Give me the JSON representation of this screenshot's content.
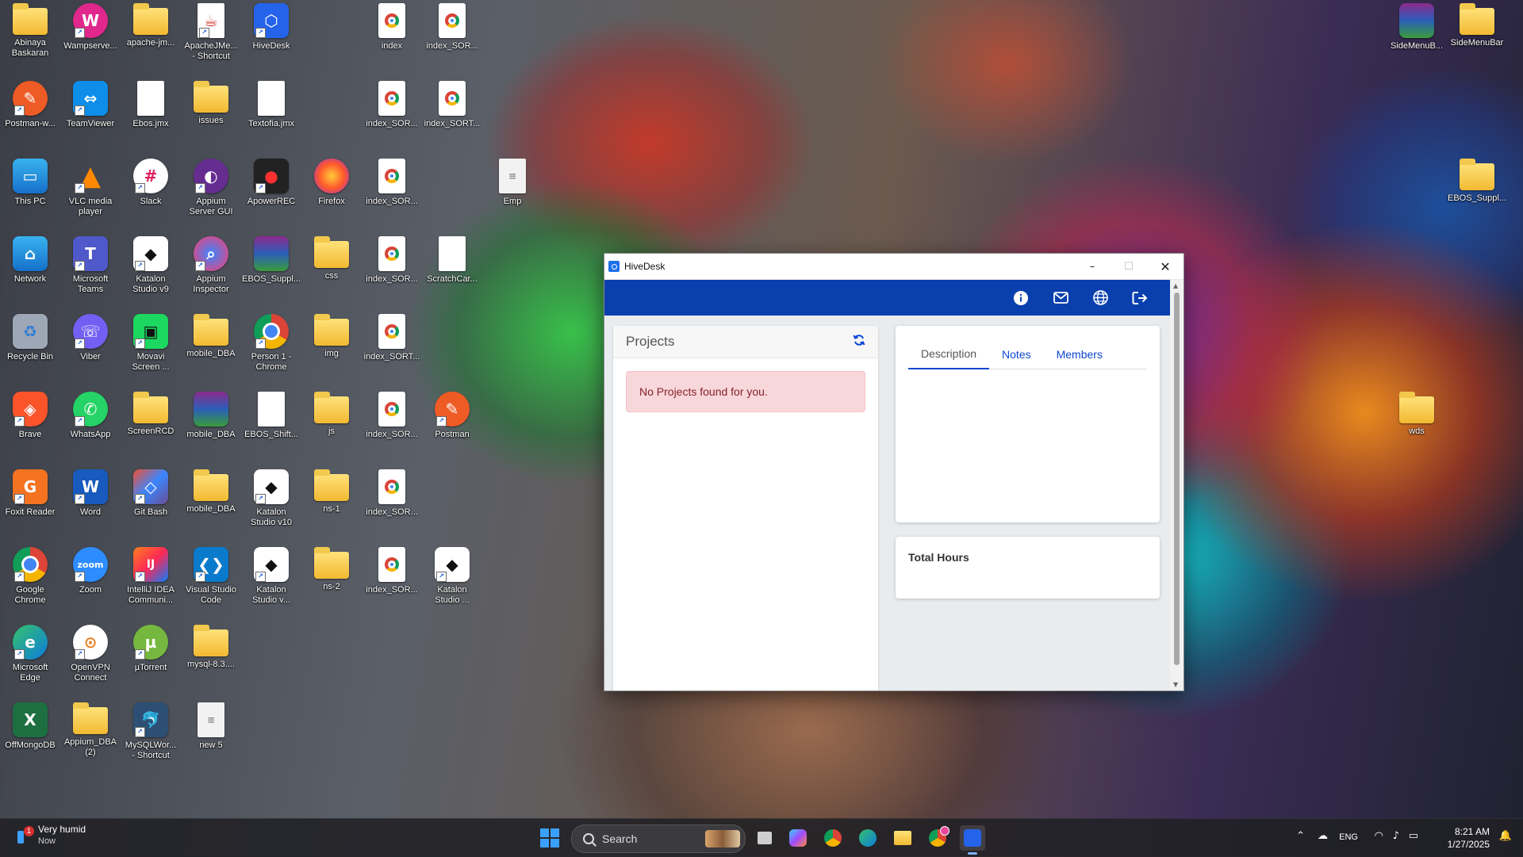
{
  "desktop": {
    "icons": [
      {
        "label": "Abinaya\nBaskaran",
        "icon": "folder-icon"
      },
      {
        "label": "Wampserve...",
        "icon": "wamp-icon"
      },
      {
        "label": "apache-jm...",
        "icon": "folder-icon"
      },
      {
        "label": "ApacheJMe...\n- Shortcut",
        "icon": "java-icon"
      },
      {
        "label": "HiveDesk",
        "icon": "hivedesk-icon"
      },
      {
        "label": "index",
        "icon": "chrome-html-icon"
      },
      {
        "label": "index_SOR...",
        "icon": "chrome-html-icon"
      },
      {
        "label": "SideMenuB...",
        "icon": "winrar-icon"
      },
      {
        "label": "SideMenuBar",
        "icon": "folder-icon"
      },
      {
        "label": "Postman-w...",
        "icon": "postman-icon"
      },
      {
        "label": "TeamViewer",
        "icon": "teamviewer-icon"
      },
      {
        "label": "Ebos.jmx",
        "icon": "file-icon"
      },
      {
        "label": "issues",
        "icon": "folder-icon"
      },
      {
        "label": "Textofia.jmx",
        "icon": "file-icon"
      },
      {
        "label": "index_SOR...",
        "icon": "chrome-html-icon"
      },
      {
        "label": "index_SORT...",
        "icon": "chrome-html-icon"
      },
      {
        "label": "This PC",
        "icon": "monitor-icon"
      },
      {
        "label": "VLC media\nplayer",
        "icon": "vlc-icon"
      },
      {
        "label": "Slack",
        "icon": "slack-icon"
      },
      {
        "label": "Appium\nServer GUI",
        "icon": "appium-icon"
      },
      {
        "label": "ApowerREC",
        "icon": "apowerrec-icon"
      },
      {
        "label": "Firefox",
        "icon": "firefox-icon"
      },
      {
        "label": "index_SOR...",
        "icon": "chrome-html-icon"
      },
      {
        "label": "Emp",
        "icon": "text-file-icon"
      },
      {
        "label": "EBOS_Suppl...",
        "icon": "folder-icon"
      },
      {
        "label": "Network",
        "icon": "network-icon"
      },
      {
        "label": "Microsoft\nTeams",
        "icon": "teams-icon"
      },
      {
        "label": "Katalon\nStudio v9",
        "icon": "katalon-icon"
      },
      {
        "label": "Appium\nInspector",
        "icon": "appium-inspector-icon"
      },
      {
        "label": "EBOS_Suppl...",
        "icon": "winrar-icon"
      },
      {
        "label": "css",
        "icon": "folder-icon"
      },
      {
        "label": "index_SOR...",
        "icon": "chrome-html-icon"
      },
      {
        "label": "ScratchCar...",
        "icon": "file-icon"
      },
      {
        "label": "Recycle Bin",
        "icon": "recycle-bin-icon"
      },
      {
        "label": "Viber",
        "icon": "viber-icon"
      },
      {
        "label": "Movavi\nScreen ...",
        "icon": "movavi-icon"
      },
      {
        "label": "mobile_DBA",
        "icon": "folder-icon"
      },
      {
        "label": "Person 1 -\nChrome",
        "icon": "chrome-icon"
      },
      {
        "label": "img",
        "icon": "folder-icon"
      },
      {
        "label": "index_SORT...",
        "icon": "chrome-html-icon"
      },
      {
        "label": "Brave",
        "icon": "brave-icon"
      },
      {
        "label": "WhatsApp",
        "icon": "whatsapp-icon"
      },
      {
        "label": "ScreenRCD",
        "icon": "folder-icon"
      },
      {
        "label": "mobile_DBA",
        "icon": "winrar-icon"
      },
      {
        "label": "EBOS_Shift...",
        "icon": "file-icon"
      },
      {
        "label": "js",
        "icon": "folder-icon"
      },
      {
        "label": "index_SOR...",
        "icon": "chrome-html-icon"
      },
      {
        "label": "Postman",
        "icon": "postman-icon"
      },
      {
        "label": "wds",
        "icon": "folder-icon"
      },
      {
        "label": "Foxit Reader",
        "icon": "foxit-icon"
      },
      {
        "label": "Word",
        "icon": "word-icon"
      },
      {
        "label": "Git Bash",
        "icon": "git-icon"
      },
      {
        "label": "mobile_DBA",
        "icon": "zip-folder-icon"
      },
      {
        "label": "Katalon\nStudio v10",
        "icon": "katalon-icon"
      },
      {
        "label": "ns-1",
        "icon": "folder-icon"
      },
      {
        "label": "index_SOR...",
        "icon": "chrome-html-icon"
      },
      {
        "label": "Google\nChrome",
        "icon": "chrome-icon"
      },
      {
        "label": "Zoom",
        "icon": "zoom-icon"
      },
      {
        "label": "IntelliJ IDEA\nCommuni...",
        "icon": "intellij-icon"
      },
      {
        "label": "Visual Studio\nCode",
        "icon": "vscode-icon"
      },
      {
        "label": "Katalon\nStudio v...",
        "icon": "katalon-icon"
      },
      {
        "label": "ns-2",
        "icon": "folder-icon"
      },
      {
        "label": "index_SOR...",
        "icon": "chrome-html-icon"
      },
      {
        "label": "Katalon\nStudio ...",
        "icon": "katalon-icon"
      },
      {
        "label": "Microsoft\nEdge",
        "icon": "edge-icon"
      },
      {
        "label": "OpenVPN\nConnect",
        "icon": "openvpn-icon"
      },
      {
        "label": "µTorrent",
        "icon": "utorrent-icon"
      },
      {
        "label": "mysql-8.3....",
        "icon": "zip-folder-icon"
      },
      {
        "label": "OffMongoDB",
        "icon": "excel-icon"
      },
      {
        "label": "Appium_DBA\n(2)",
        "icon": "zip-folder-icon"
      },
      {
        "label": "MySQLWor...\n- Shortcut",
        "icon": "mysql-workbench-icon"
      },
      {
        "label": "new 5",
        "icon": "text-file-icon"
      }
    ]
  },
  "window": {
    "title": "HiveDesk",
    "controls": {
      "minimize": "–",
      "maximize": "☐",
      "close": "✕"
    }
  },
  "header": {
    "icons": [
      "info-icon",
      "mail-icon",
      "globe-icon",
      "logout-icon"
    ]
  },
  "projects": {
    "title": "Projects",
    "empty_message": "No Projects found for you."
  },
  "tabs": [
    {
      "label": "Description",
      "active": true
    },
    {
      "label": "Notes",
      "active": false
    },
    {
      "label": "Members",
      "active": false
    }
  ],
  "hours": {
    "title": "Total Hours"
  },
  "taskbar": {
    "weather": {
      "title": "Very humid",
      "subtitle": "Now",
      "badge": "1"
    },
    "search_placeholder": "Search",
    "apps": [
      "task-view-icon",
      "copilot-icon",
      "chrome-icon",
      "edge-icon",
      "file-explorer-icon",
      "chrome-profile-icon",
      "hivedesk-icon"
    ],
    "language": "ENG",
    "time": "8:21 AM",
    "date": "1/27/2025"
  }
}
